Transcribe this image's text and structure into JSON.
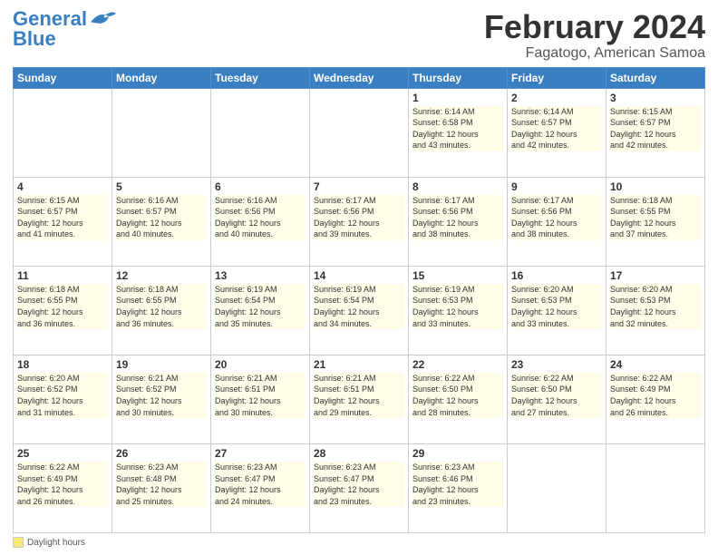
{
  "header": {
    "logo_line1": "General",
    "logo_line2": "Blue",
    "month_title": "February 2024",
    "location": "Fagatogo, American Samoa"
  },
  "days_of_week": [
    "Sunday",
    "Monday",
    "Tuesday",
    "Wednesday",
    "Thursday",
    "Friday",
    "Saturday"
  ],
  "footer": {
    "legend_label": "Daylight hours"
  },
  "weeks": [
    [
      {
        "day": "",
        "info": ""
      },
      {
        "day": "",
        "info": ""
      },
      {
        "day": "",
        "info": ""
      },
      {
        "day": "",
        "info": ""
      },
      {
        "day": "1",
        "info": "Sunrise: 6:14 AM\nSunset: 6:58 PM\nDaylight: 12 hours\nand 43 minutes."
      },
      {
        "day": "2",
        "info": "Sunrise: 6:14 AM\nSunset: 6:57 PM\nDaylight: 12 hours\nand 42 minutes."
      },
      {
        "day": "3",
        "info": "Sunrise: 6:15 AM\nSunset: 6:57 PM\nDaylight: 12 hours\nand 42 minutes."
      }
    ],
    [
      {
        "day": "4",
        "info": "Sunrise: 6:15 AM\nSunset: 6:57 PM\nDaylight: 12 hours\nand 41 minutes."
      },
      {
        "day": "5",
        "info": "Sunrise: 6:16 AM\nSunset: 6:57 PM\nDaylight: 12 hours\nand 40 minutes."
      },
      {
        "day": "6",
        "info": "Sunrise: 6:16 AM\nSunset: 6:56 PM\nDaylight: 12 hours\nand 40 minutes."
      },
      {
        "day": "7",
        "info": "Sunrise: 6:17 AM\nSunset: 6:56 PM\nDaylight: 12 hours\nand 39 minutes."
      },
      {
        "day": "8",
        "info": "Sunrise: 6:17 AM\nSunset: 6:56 PM\nDaylight: 12 hours\nand 38 minutes."
      },
      {
        "day": "9",
        "info": "Sunrise: 6:17 AM\nSunset: 6:56 PM\nDaylight: 12 hours\nand 38 minutes."
      },
      {
        "day": "10",
        "info": "Sunrise: 6:18 AM\nSunset: 6:55 PM\nDaylight: 12 hours\nand 37 minutes."
      }
    ],
    [
      {
        "day": "11",
        "info": "Sunrise: 6:18 AM\nSunset: 6:55 PM\nDaylight: 12 hours\nand 36 minutes."
      },
      {
        "day": "12",
        "info": "Sunrise: 6:18 AM\nSunset: 6:55 PM\nDaylight: 12 hours\nand 36 minutes."
      },
      {
        "day": "13",
        "info": "Sunrise: 6:19 AM\nSunset: 6:54 PM\nDaylight: 12 hours\nand 35 minutes."
      },
      {
        "day": "14",
        "info": "Sunrise: 6:19 AM\nSunset: 6:54 PM\nDaylight: 12 hours\nand 34 minutes."
      },
      {
        "day": "15",
        "info": "Sunrise: 6:19 AM\nSunset: 6:53 PM\nDaylight: 12 hours\nand 33 minutes."
      },
      {
        "day": "16",
        "info": "Sunrise: 6:20 AM\nSunset: 6:53 PM\nDaylight: 12 hours\nand 33 minutes."
      },
      {
        "day": "17",
        "info": "Sunrise: 6:20 AM\nSunset: 6:53 PM\nDaylight: 12 hours\nand 32 minutes."
      }
    ],
    [
      {
        "day": "18",
        "info": "Sunrise: 6:20 AM\nSunset: 6:52 PM\nDaylight: 12 hours\nand 31 minutes."
      },
      {
        "day": "19",
        "info": "Sunrise: 6:21 AM\nSunset: 6:52 PM\nDaylight: 12 hours\nand 30 minutes."
      },
      {
        "day": "20",
        "info": "Sunrise: 6:21 AM\nSunset: 6:51 PM\nDaylight: 12 hours\nand 30 minutes."
      },
      {
        "day": "21",
        "info": "Sunrise: 6:21 AM\nSunset: 6:51 PM\nDaylight: 12 hours\nand 29 minutes."
      },
      {
        "day": "22",
        "info": "Sunrise: 6:22 AM\nSunset: 6:50 PM\nDaylight: 12 hours\nand 28 minutes."
      },
      {
        "day": "23",
        "info": "Sunrise: 6:22 AM\nSunset: 6:50 PM\nDaylight: 12 hours\nand 27 minutes."
      },
      {
        "day": "24",
        "info": "Sunrise: 6:22 AM\nSunset: 6:49 PM\nDaylight: 12 hours\nand 26 minutes."
      }
    ],
    [
      {
        "day": "25",
        "info": "Sunrise: 6:22 AM\nSunset: 6:49 PM\nDaylight: 12 hours\nand 26 minutes."
      },
      {
        "day": "26",
        "info": "Sunrise: 6:23 AM\nSunset: 6:48 PM\nDaylight: 12 hours\nand 25 minutes."
      },
      {
        "day": "27",
        "info": "Sunrise: 6:23 AM\nSunset: 6:47 PM\nDaylight: 12 hours\nand 24 minutes."
      },
      {
        "day": "28",
        "info": "Sunrise: 6:23 AM\nSunset: 6:47 PM\nDaylight: 12 hours\nand 23 minutes."
      },
      {
        "day": "29",
        "info": "Sunrise: 6:23 AM\nSunset: 6:46 PM\nDaylight: 12 hours\nand 23 minutes."
      },
      {
        "day": "",
        "info": ""
      },
      {
        "day": "",
        "info": ""
      }
    ]
  ]
}
